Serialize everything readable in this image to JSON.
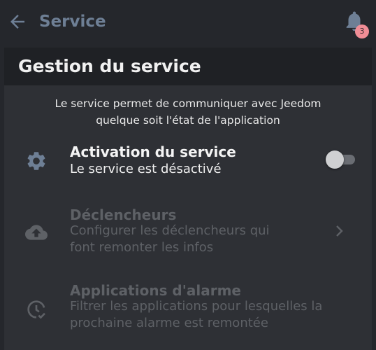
{
  "appbar": {
    "title": "Service",
    "notification_count": "3"
  },
  "panel": {
    "title": "Gestion du service",
    "description_lines": [
      "Le service permet de communiquer avec Jeedom",
      "quelque soit l'état de l'application"
    ]
  },
  "settings": [
    {
      "icon": "gear-icon",
      "title": "Activation du service",
      "subtitle_lines": [
        "Le service est désactivé"
      ],
      "enabled": true,
      "control": "toggle",
      "toggle_on": false
    },
    {
      "icon": "cloud-upload-icon",
      "title": "Déclencheurs",
      "subtitle_lines": [
        "Configurer les déclencheurs qui",
        "font remonter les infos"
      ],
      "enabled": false,
      "control": "chevron"
    },
    {
      "icon": "alarm-check-icon",
      "title": "Applications d'alarme",
      "subtitle_lines": [
        "Filtrer les applications pour lesquelles la",
        "prochaine alarme est remontée"
      ],
      "enabled": false,
      "control": "none"
    }
  ],
  "colors": {
    "background": "#25272c",
    "panel": "#2e3035",
    "panel_header": "#1f2125",
    "accent_muted": "#6e7f95",
    "badge": "#f08d96",
    "disabled_text": "#5e6166"
  }
}
